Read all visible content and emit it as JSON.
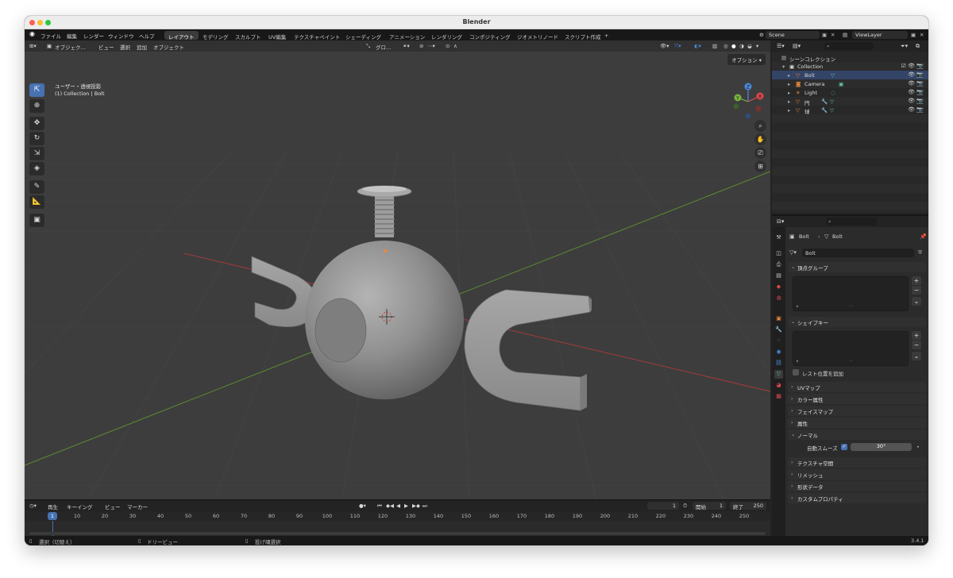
{
  "window": {
    "title": "Blender"
  },
  "menubar": {
    "menus": [
      "ファイル",
      "編集",
      "レンダー",
      "ウィンドウ",
      "ヘルプ"
    ],
    "workspaces": [
      "レイアウト",
      "モデリング",
      "スカルプト",
      "UV編集",
      "テクスチャペイント",
      "シェーディング",
      "アニメーション",
      "レンダリング",
      "コンポジティング",
      "ジオメトリノード",
      "スクリプト作成"
    ],
    "active_workspace": "レイアウト",
    "add_tab": "+",
    "scene": "Scene",
    "view_layer": "ViewLayer"
  },
  "viewport": {
    "mode": "オブジェク…",
    "menus": [
      "ビュー",
      "選択",
      "追加",
      "オブジェクト"
    ],
    "transform_orientation": "グロ…",
    "options_label": "オプション",
    "view_name": "ユーザー・透視投影",
    "object_info": "(1) Collection | Bolt",
    "gizmo_axes": [
      "X",
      "Y",
      "Z"
    ]
  },
  "timeline": {
    "menus": [
      "再生",
      "キーイング",
      "ビュー",
      "マーカー"
    ],
    "current_frame": "1",
    "start_label": "開始",
    "start": "1",
    "end_label": "終了",
    "end": "250",
    "ticks": [
      "10",
      "20",
      "30",
      "40",
      "50",
      "60",
      "70",
      "80",
      "90",
      "100",
      "110",
      "120",
      "130",
      "140",
      "150",
      "160",
      "170",
      "180",
      "190",
      "200",
      "210",
      "220",
      "230",
      "240",
      "250"
    ],
    "marker_frame": "1"
  },
  "statusbar": {
    "select": "選択（切替え）",
    "dolly": "ドリービュー",
    "lasso": "投げ縄選択",
    "version": "3.4.1"
  },
  "outliner": {
    "root": "シーンコレクション",
    "collection": "Collection",
    "items": [
      {
        "name": "Bolt",
        "color": "#e8873a"
      },
      {
        "name": "Camera",
        "color": "#e8873a"
      },
      {
        "name": "Light",
        "color": "#e8873a"
      },
      {
        "name": "円",
        "color": "#e8873a"
      },
      {
        "name": "球",
        "color": "#e8873a"
      }
    ]
  },
  "properties": {
    "breadcrumb_object": "Bolt",
    "breadcrumb_data": "Bolt",
    "datablock_name": "Bolt",
    "panels": {
      "vertex_groups": "頂点グループ",
      "shape_keys": "シェイプキー",
      "relative_position": "レスト位置を追加",
      "uv_maps": "UVマップ",
      "color_attributes": "カラー属性",
      "face_maps": "フェイスマップ",
      "attributes": "属性",
      "normals": "ノーマル",
      "auto_smooth_label": "自動スムーズ",
      "auto_smooth_angle": "30°",
      "texture_space": "テクスチャ空間",
      "remesh": "リメッシュ",
      "geometry_data": "形状データ",
      "custom_properties": "カスタムプロパティ"
    }
  },
  "colors": {
    "accent": "#4772b3",
    "x_axis": "#e0474c",
    "y_axis": "#76b53e",
    "z_axis": "#4b8ad9",
    "mesh_icon": "#5fc8a8"
  }
}
